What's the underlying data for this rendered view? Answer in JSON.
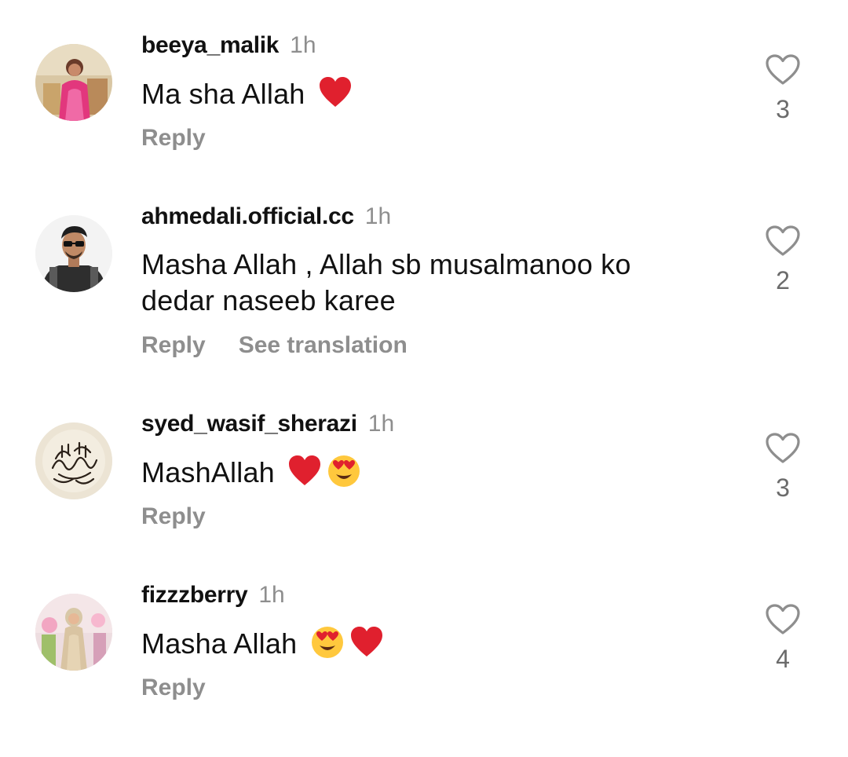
{
  "comments": [
    {
      "username": "beeya_malik",
      "time": "1h",
      "text": "Ma sha Allah",
      "emojis": [
        "red-heart"
      ],
      "reply_label": "Reply",
      "like_count": "3",
      "avatar_icon": "user-photo-pink-dress"
    },
    {
      "username": "ahmedali.official.cc",
      "time": "1h",
      "text": "Masha Allah , Allah sb musalmanoo ko dedar naseeb karee",
      "emojis": [],
      "reply_label": "Reply",
      "translate_label": "See translation",
      "like_count": "2",
      "avatar_icon": "user-photo-man-sunglasses"
    },
    {
      "username": "syed_wasif_sherazi",
      "time": "1h",
      "text": "MashAllah",
      "emojis": [
        "red-heart",
        "heart-eyes"
      ],
      "reply_label": "Reply",
      "like_count": "3",
      "avatar_icon": "calligraphy-emblem"
    },
    {
      "username": "fizzzberry",
      "time": "1h",
      "text": "Masha Allah",
      "emojis": [
        "heart-eyes",
        "red-heart"
      ],
      "reply_label": "Reply",
      "like_count": "4",
      "avatar_icon": "user-photo-woman-hijab"
    }
  ],
  "colors": {
    "text_primary": "#111111",
    "text_secondary": "#8e8e8e",
    "like_count": "#6b6b6b",
    "heart_outline": "#8e8e8e",
    "emoji_heart": "#e0202e",
    "emoji_face": "#ffc83d"
  }
}
